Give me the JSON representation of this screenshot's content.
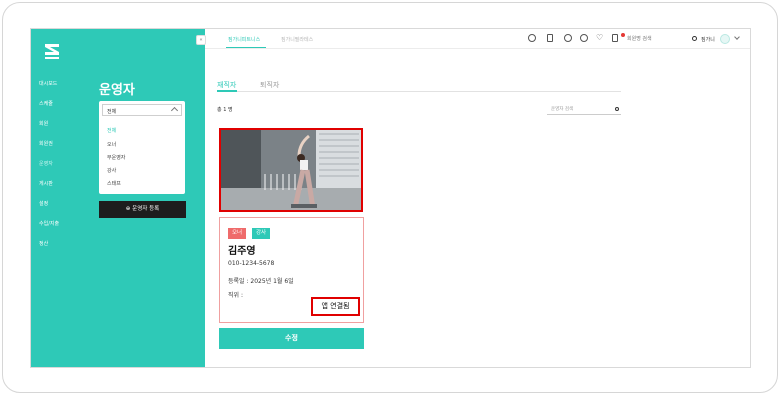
{
  "brand": {
    "logo_text": "ZIMGAIN",
    "accent": "#2ec9b7"
  },
  "sidebar": {
    "items": [
      {
        "label": "대시보드"
      },
      {
        "label": "스케줄"
      },
      {
        "label": "회원"
      },
      {
        "label": "회원권"
      },
      {
        "label": "운영자",
        "active": true
      },
      {
        "label": "게시판"
      },
      {
        "label": "설정"
      },
      {
        "label": "수입/지출"
      },
      {
        "label": "정산"
      }
    ],
    "collapse_label": "«"
  },
  "section": {
    "title": "운영자",
    "filter": {
      "selected": "전체",
      "options": [
        "전체",
        "오너",
        "부운영자",
        "강사",
        "스태프"
      ]
    },
    "register_button": "운영자 등록"
  },
  "topbar": {
    "tabs": [
      {
        "label": "짐가니피트니스",
        "active": true
      },
      {
        "label": "짐가니필라테스",
        "active": false
      }
    ],
    "member_search_placeholder": "회원명 검색",
    "user_name": "짐가니"
  },
  "content": {
    "tabs": [
      {
        "label": "재직자",
        "active": true
      },
      {
        "label": "퇴직자",
        "active": false
      }
    ],
    "total": "총 1 명",
    "staff_search_placeholder": "운영자 검색"
  },
  "staff_card": {
    "badges": [
      "오너",
      "강사"
    ],
    "name": "김주영",
    "phone": "010-1234-5678",
    "registered": "등록일 : 2025년 1월 6일",
    "position": "직위 :",
    "app_status": "앱 연결됨"
  },
  "edit_button": "수정"
}
